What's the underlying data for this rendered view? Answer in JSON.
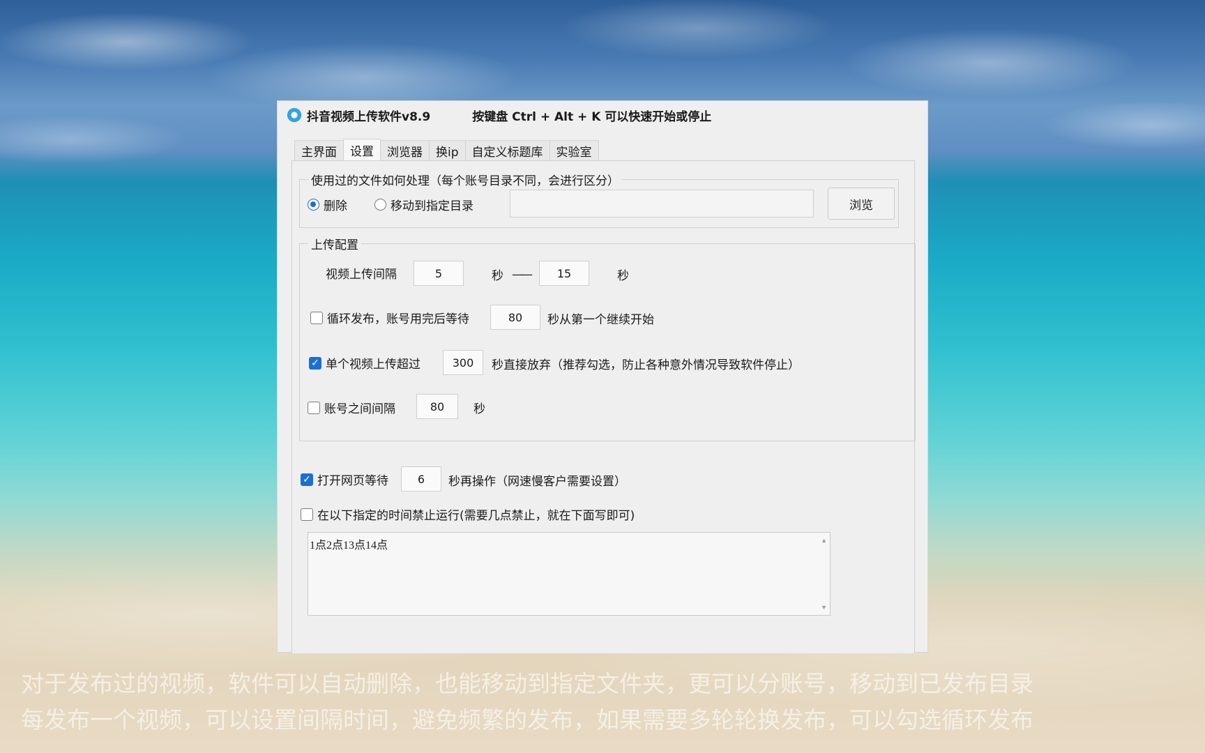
{
  "window": {
    "title": "抖音视频上传软件v8.9",
    "hotkey_hint": "按键盘 Ctrl + Alt + K  可以快速开始或停止"
  },
  "tabs": [
    "主界面",
    "设置",
    "浏览器",
    "换ip",
    "自定义标题库",
    "实验室"
  ],
  "file_handling": {
    "legend": "使用过的文件如何处理（每个账号目录不同，会进行区分）",
    "option_delete": "删除",
    "option_move": "移动到指定目录",
    "path_value": "",
    "browse_label": "浏览"
  },
  "upload_config": {
    "legend": "上传配置",
    "interval_label": "视频上传间隔",
    "interval_min": "5",
    "unit_sec": "秒",
    "dash": "——",
    "interval_max": "15",
    "loop_label": "循环发布，账号用完后等待",
    "loop_wait": "80",
    "loop_suffix": "秒从第一个继续开始",
    "timeout_label": "单个视频上传超过",
    "timeout_value": "300",
    "timeout_suffix": "秒直接放弃（推荐勾选，防止各种意外情况导致软件停止）",
    "account_gap_label": "账号之间间隔",
    "account_gap_value": "80"
  },
  "page_wait": {
    "label": "打开网页等待",
    "value": "6",
    "suffix": "秒再操作（网速慢客户需要设置）"
  },
  "forbid_time": {
    "label": "在以下指定的时间禁止运行(需要几点禁止，就在下面写即可)",
    "value": "1点2点13点14点"
  },
  "subtitles": [
    "对于发布过的视频，软件可以自动删除，也能移动到指定文件夹，更可以分账号，移动到已发布目录",
    "每发布一个视频，可以设置间隔时间，避免频繁的发布，如果需要多轮轮换发布，可以勾选循环发布"
  ]
}
